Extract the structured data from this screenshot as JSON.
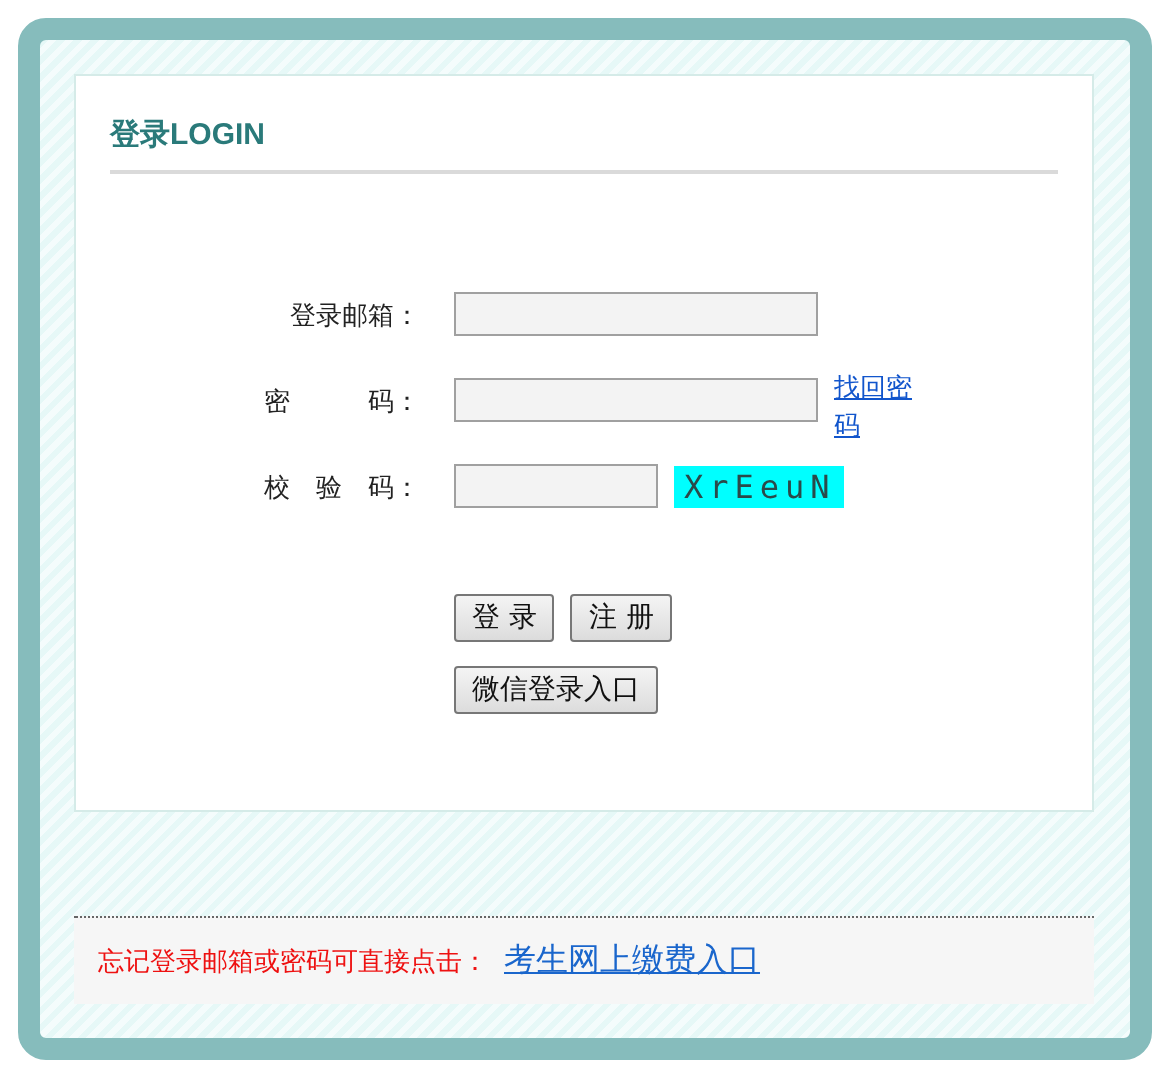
{
  "panel": {
    "title": "登录LOGIN"
  },
  "fields": [
    {
      "label": "登录邮箱：",
      "kind": "text"
    },
    {
      "label": "密　　　码：",
      "kind": "password",
      "extra": {
        "kind": "link",
        "text": "找回密码"
      }
    },
    {
      "label": "校　验　码：",
      "kind": "captcha",
      "extra": {
        "kind": "captcha",
        "text": "XrEeuN"
      }
    }
  ],
  "buttons": [
    {
      "label": "登 录"
    },
    {
      "label": "注 册"
    }
  ],
  "wechat_button": {
    "label": "微信登录入口"
  },
  "footer": {
    "note": "忘记登录邮箱或密码可直接点击：",
    "link": "考生网上缴费入口"
  }
}
